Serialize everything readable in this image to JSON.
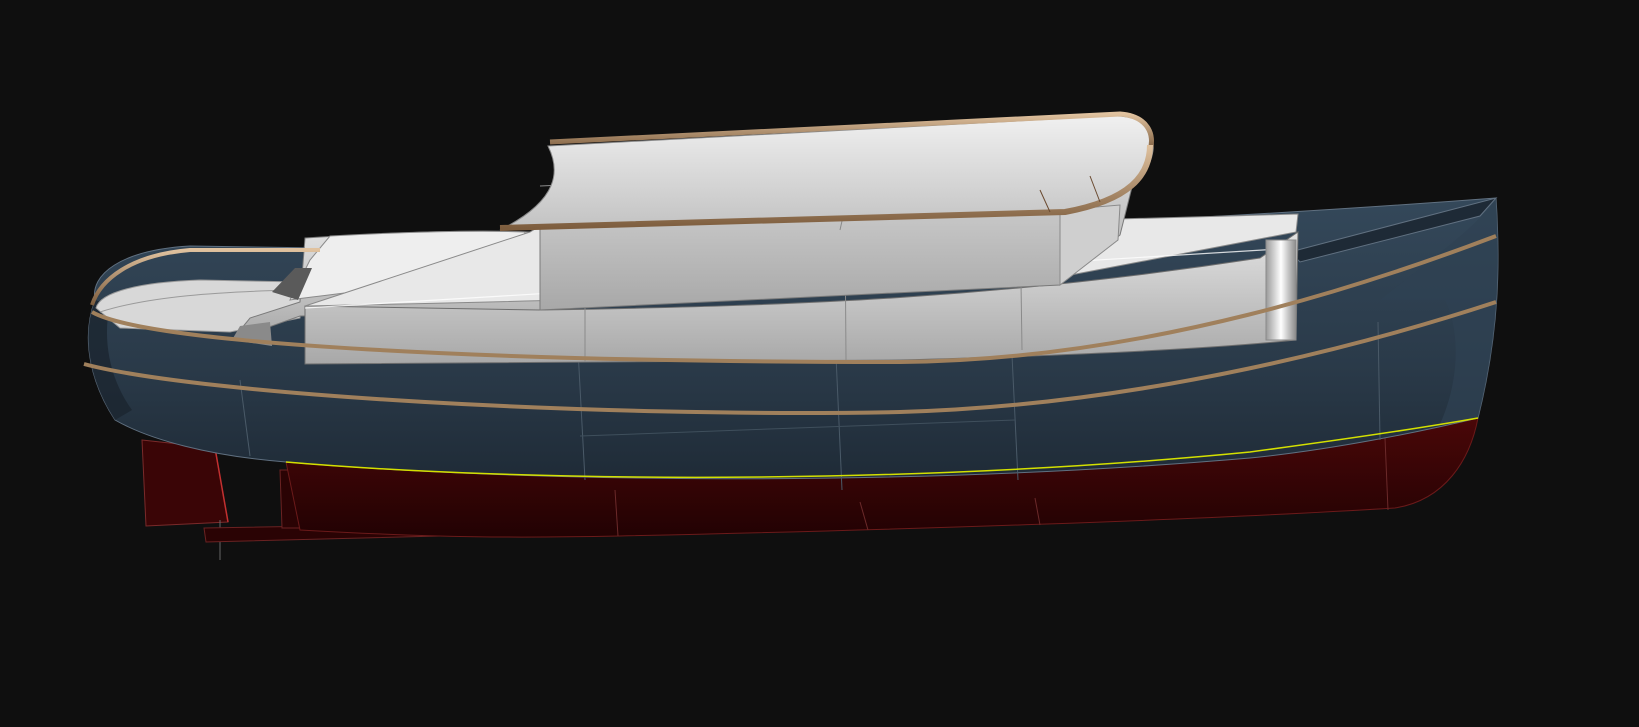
{
  "scene": {
    "background": "#0f0f0f",
    "colors": {
      "hull_topsides": "#2b3a48",
      "hull_topsides_dark": "#1f2a35",
      "bottom_paint": "#3a0506",
      "bottom_paint_dark": "#250304",
      "superstructure": "#c9c9c9",
      "superstructure_light": "#e6e6e6",
      "superstructure_shadow": "#9a9a9a",
      "trim_wood": "#b08a64",
      "waterline": "#d4e000",
      "edge_lines": "#5a6a78"
    },
    "objects": [
      "hull",
      "bottom",
      "keel",
      "rudder",
      "deckhouse",
      "wheelhouse",
      "roof",
      "rub-rails",
      "waterline"
    ]
  }
}
